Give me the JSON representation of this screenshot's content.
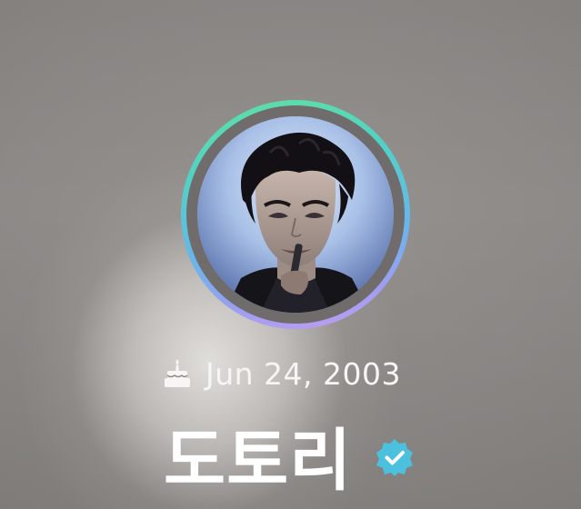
{
  "profile": {
    "birthday": "Jun 24, 2003",
    "name": "도토리",
    "verified": true
  },
  "icons": {
    "birthday": "cake-icon",
    "verified": "verified-badge-icon"
  },
  "colors": {
    "ring_top": "#5fe0a3",
    "ring_mid": "#67b6ea",
    "ring_bottom": "#c59df0",
    "verified_badge": "#4cc1de",
    "text": "#ffffff"
  }
}
